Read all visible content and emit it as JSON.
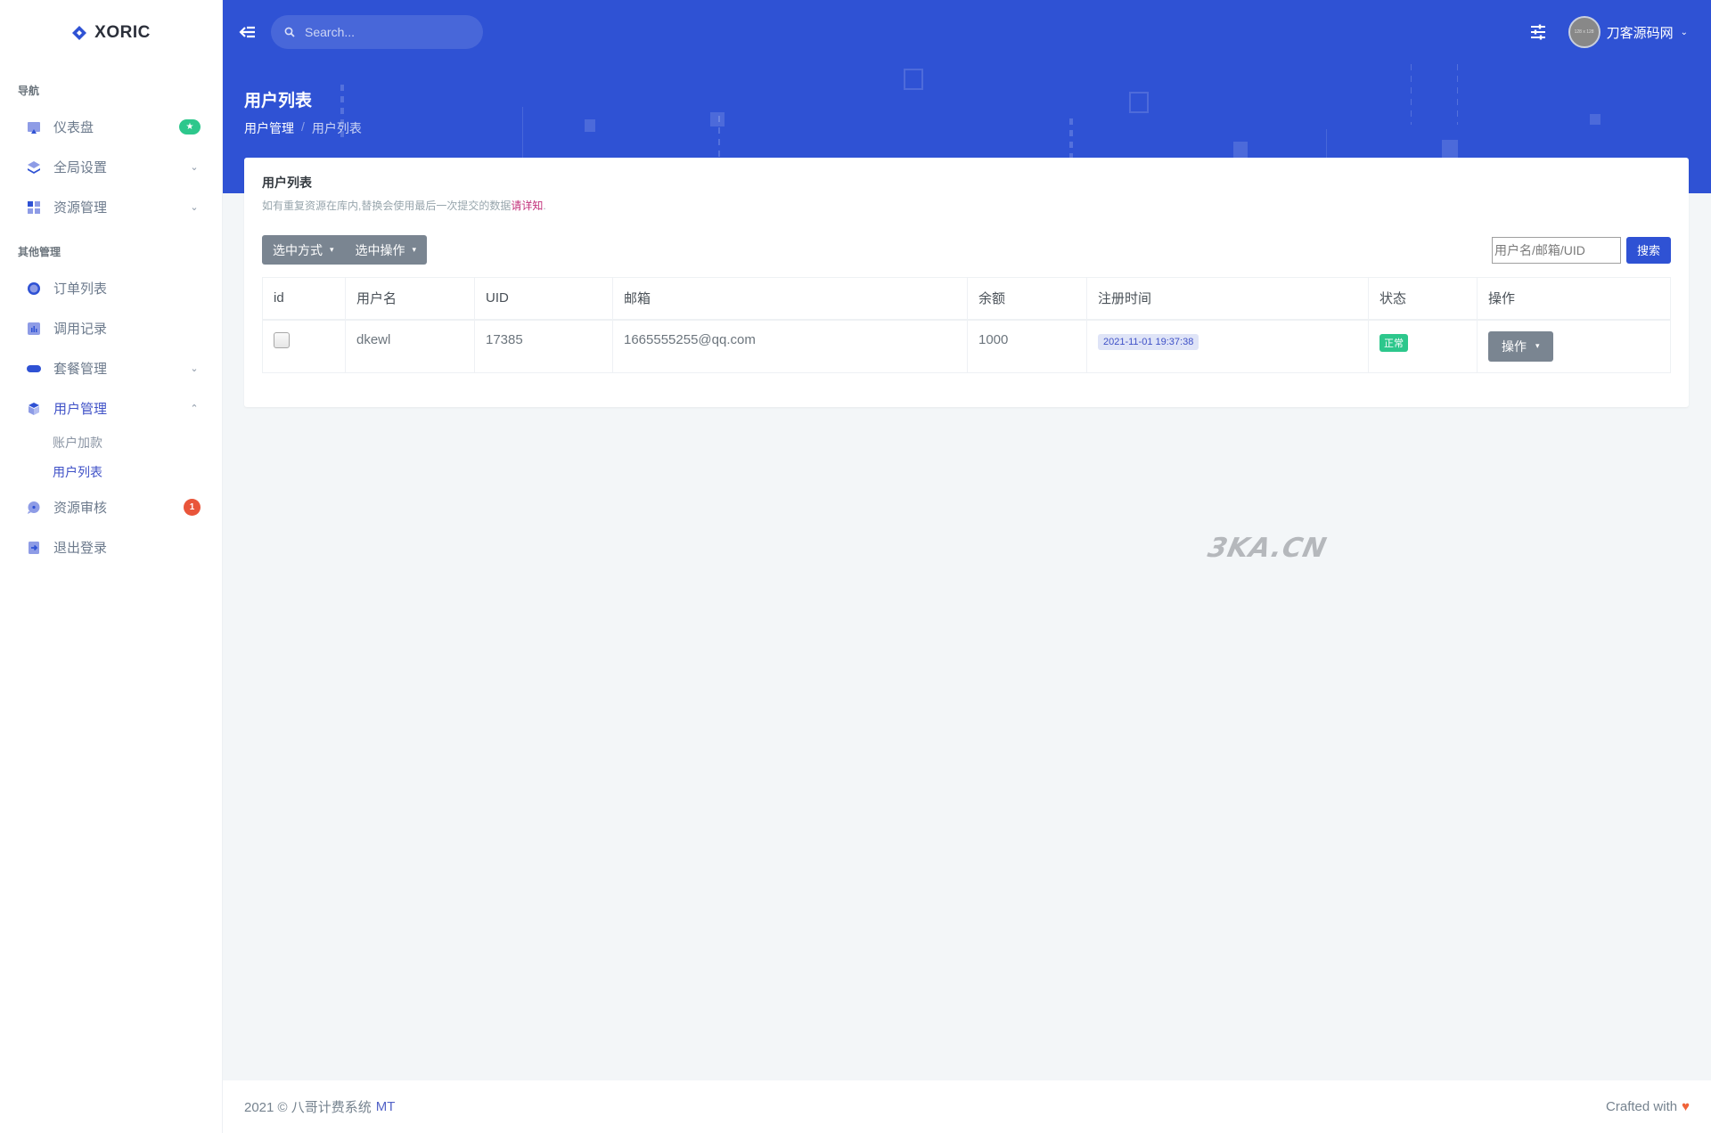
{
  "brand": {
    "name": "XORIC"
  },
  "sidebar": {
    "sections": [
      {
        "title": "导航"
      },
      {
        "title": "其他管理"
      }
    ],
    "items": [
      {
        "label": "仪表盘",
        "icon": "dashboard-icon",
        "badge": "★"
      },
      {
        "label": "全局设置",
        "icon": "layers-icon",
        "chevron": "⌄"
      },
      {
        "label": "资源管理",
        "icon": "grid-icon",
        "chevron": "⌄"
      },
      {
        "label": "订单列表",
        "icon": "circle-icon"
      },
      {
        "label": "调用记录",
        "icon": "chart-icon"
      },
      {
        "label": "套餐管理",
        "icon": "pill-icon",
        "chevron": "⌄"
      },
      {
        "label": "用户管理",
        "icon": "box-icon",
        "chevron": "⌃",
        "active": true,
        "children": [
          {
            "label": "账户加款"
          },
          {
            "label": "用户列表",
            "active": true
          }
        ]
      },
      {
        "label": "资源审核",
        "icon": "chat-icon",
        "badge": "1"
      },
      {
        "label": "退出登录",
        "icon": "logout-icon"
      }
    ]
  },
  "topbar": {
    "search_placeholder": "Search...",
    "username": "刀客源码网",
    "avatar_text": "128 x 128"
  },
  "page": {
    "title": "用户列表",
    "breadcrumb": [
      "用户管理",
      "/",
      "用户列表"
    ]
  },
  "card": {
    "title": "用户列表",
    "subtitle": "如有重复资源在库内,替换会使用最后一次提交的数据",
    "notice_link": "请详知",
    "notice_end": ".",
    "toolbar": {
      "select_mode": "选中方式",
      "select_action": "选中操作",
      "search_placeholder": "用户名/邮箱/UID",
      "search_button": "搜索"
    },
    "table": {
      "columns": [
        "id",
        "用户名",
        "UID",
        "邮箱",
        "余额",
        "注册时间",
        "状态",
        "操作"
      ],
      "rows": [
        {
          "username": "dkewl",
          "uid": "17385",
          "email": "1665555255@qq.com",
          "balance": "1000",
          "registered": "2021-11-01 19:37:38",
          "status": "正常",
          "action": "操作"
        }
      ]
    }
  },
  "watermark": "3KA.CN",
  "footer": {
    "copyright": "2021 © 八哥计费系统",
    "brand": "MT",
    "crafted": "Crafted with"
  },
  "colors": {
    "primary": "#2f52d4",
    "success": "#2dc78c",
    "danger": "#e9553a",
    "secondary": "#7a8591"
  }
}
